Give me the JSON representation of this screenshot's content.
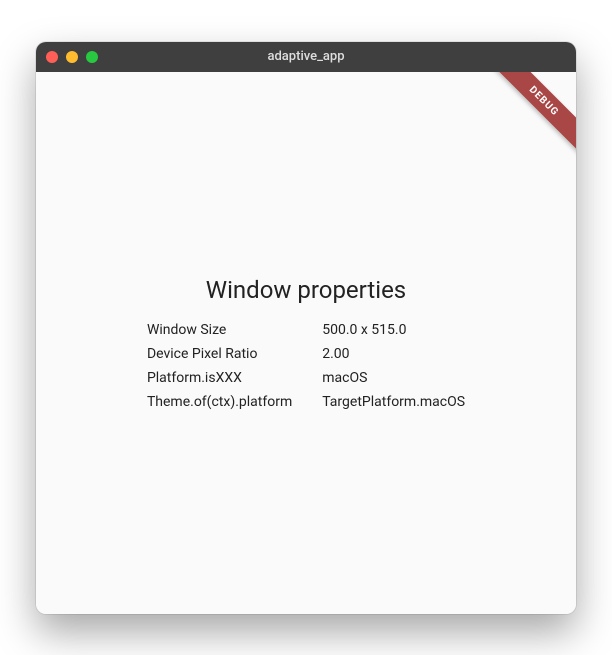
{
  "window": {
    "title": "adaptive_app"
  },
  "debug_banner": "DEBUG",
  "heading": "Window properties",
  "properties": [
    {
      "label": "Window Size",
      "value": "500.0 x 515.0"
    },
    {
      "label": "Device Pixel Ratio",
      "value": "2.00"
    },
    {
      "label": "Platform.isXXX",
      "value": "macOS"
    },
    {
      "label": "Theme.of(ctx).platform",
      "value": "TargetPlatform.macOS"
    }
  ]
}
